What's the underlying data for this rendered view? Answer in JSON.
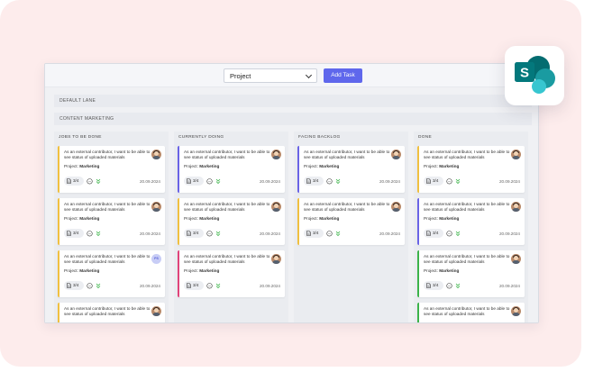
{
  "toolbar": {
    "project_select": "Project",
    "add_task_label": "Add Task"
  },
  "lanes": {
    "default": "DEFAULT LANE",
    "content": "CONTENT MARKETING"
  },
  "columns": [
    {
      "title": "JOBS TO BE DONE",
      "cards": [
        {
          "description": "As an external contributor, I want to be able to see status of uploaded materials",
          "project_label": "Project:",
          "project": "Marketing",
          "attachments": "3/4",
          "date": "20.09.2024",
          "accent": "#f0c040",
          "avatar": "photo"
        },
        {
          "description": "As an external contributor, I want to be able to see status of uploaded materials",
          "project_label": "Project:",
          "project": "Marketing",
          "attachments": "3/4",
          "date": "20.09.2024",
          "accent": "#f0c040",
          "avatar": "photo"
        },
        {
          "description": "As an external contributor, I want to be able to see status of uploaded materials",
          "project_label": "Project:",
          "project": "Marketing",
          "attachments": "3/4",
          "date": "20.09.2024",
          "accent": "#f0c040",
          "avatar": "initials",
          "initials": "PS"
        },
        {
          "description": "As an external contributor, I want to be able to see status of uploaded materials",
          "project_label": "",
          "project": "",
          "attachments": "",
          "date": "",
          "accent": "#f0c040",
          "avatar": "photo"
        }
      ]
    },
    {
      "title": "CURRENTLY DOING",
      "cards": [
        {
          "description": "As an external contributor, I want to be able to see status of uploaded materials",
          "project_label": "Project:",
          "project": "Marketing",
          "attachments": "3/4",
          "date": "20.09.2024",
          "accent": "#6a63e6",
          "avatar": "photo"
        },
        {
          "description": "As an external contributor, I want to be able to see status of uploaded materials",
          "project_label": "Project:",
          "project": "Marketing",
          "attachments": "3/4",
          "date": "20.09.2024",
          "accent": "#f0c040",
          "avatar": "photo"
        },
        {
          "description": "As an external contributor, I want to be able to see status of uploaded materials",
          "project_label": "Project:",
          "project": "Marketing",
          "attachments": "3/4",
          "date": "20.09.2024",
          "accent": "#e0437a",
          "avatar": "photo"
        }
      ]
    },
    {
      "title": "FACING BACKLOG",
      "cards": [
        {
          "description": "As an external contributor, I want to be able to see status of uploaded materials",
          "project_label": "Project:",
          "project": "Marketing",
          "attachments": "3/4",
          "date": "20.09.2024",
          "accent": "#6a63e6",
          "avatar": "photo"
        },
        {
          "description": "As an external contributor, I want to be able to see status of uploaded materials",
          "project_label": "Project:",
          "project": "Marketing",
          "attachments": "3/4",
          "date": "20.09.2024",
          "accent": "#f0c040",
          "avatar": "photo"
        }
      ]
    },
    {
      "title": "DONE",
      "cards": [
        {
          "description": "As an external contributor, I want to be able to see status of uploaded materials",
          "project_label": "Project:",
          "project": "Marketing",
          "attachments": "3/4",
          "date": "20.09.2024",
          "accent": "#f0c040",
          "avatar": "photo"
        },
        {
          "description": "As an external contributor, I want to be able to see status of uploaded materials",
          "project_label": "Project:",
          "project": "Marketing",
          "attachments": "3/4",
          "date": "20.09.2024",
          "accent": "#6a63e6",
          "avatar": "photo"
        },
        {
          "description": "As an external contributor, I want to be able to see status of uploaded materials",
          "project_label": "Project:",
          "project": "Marketing",
          "attachments": "3/4",
          "date": "20.09.2024",
          "accent": "#3cb34a",
          "avatar": "photo"
        },
        {
          "description": "As an external contributor, I want to be able to see status of uploaded materials",
          "project_label": "",
          "project": "",
          "attachments": "",
          "date": "",
          "accent": "#3cb34a",
          "avatar": "photo"
        }
      ]
    }
  ],
  "app_icon": "sharepoint-icon"
}
